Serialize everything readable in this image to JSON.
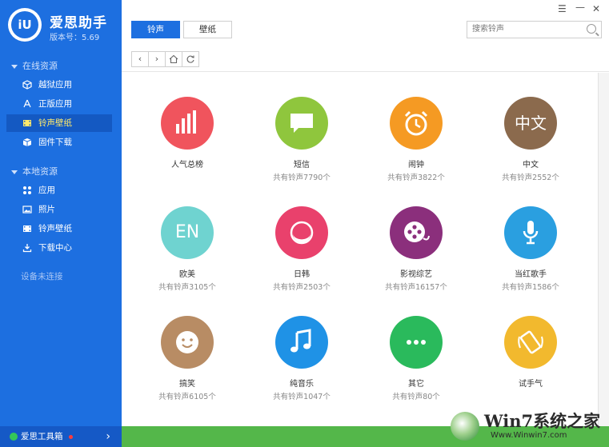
{
  "app": {
    "name": "爱思助手",
    "version": "版本号：5.69",
    "logo_text": "iU"
  },
  "sidebar": {
    "online_title": "在线资源",
    "online_items": [
      {
        "label": "越狱应用",
        "icon": "cube-icon"
      },
      {
        "label": "正版应用",
        "icon": "appstore-icon"
      },
      {
        "label": "铃声壁纸",
        "icon": "film-icon",
        "active": true
      },
      {
        "label": "固件下载",
        "icon": "box-icon"
      }
    ],
    "local_title": "本地资源",
    "local_items": [
      {
        "label": "应用",
        "icon": "apps-grid-icon"
      },
      {
        "label": "照片",
        "icon": "photo-icon"
      },
      {
        "label": "铃声壁纸",
        "icon": "film-icon"
      },
      {
        "label": "下载中心",
        "icon": "download-icon"
      }
    ],
    "device_status": "设备未连接",
    "toolbox_label": "爱思工具箱"
  },
  "topbar": {
    "tabs": [
      {
        "label": "铃声"
      },
      {
        "label": "壁纸"
      }
    ],
    "search_placeholder": "搜索铃声",
    "window_controls": [
      "menu-icon",
      "minimize-icon",
      "close-icon"
    ]
  },
  "categories": [
    {
      "name": "人气总榜",
      "count": "",
      "color": "#f0545d",
      "icon": "bar-chart-icon"
    },
    {
      "name": "短信",
      "count": "共有铃声7790个",
      "color": "#8fc63d",
      "icon": "message-icon"
    },
    {
      "name": "闹钟",
      "count": "共有铃声3822个",
      "color": "#f59a23",
      "icon": "alarm-clock-icon"
    },
    {
      "name": "中文",
      "count": "共有铃声2552个",
      "color": "#8b6a4d",
      "icon": "chinese-text-icon",
      "glyph": "中文"
    },
    {
      "name": "欧美",
      "count": "共有铃声3105个",
      "color": "#6fd3d0",
      "icon": "english-text-icon",
      "glyph": "EN"
    },
    {
      "name": "日韩",
      "count": "共有铃声2503个",
      "color": "#e9416c",
      "icon": "crescent-icon"
    },
    {
      "name": "影视综艺",
      "count": "共有铃声16157个",
      "color": "#8b2f7c",
      "icon": "film-reel-icon"
    },
    {
      "name": "当红歌手",
      "count": "共有铃声1586个",
      "color": "#2a9fe0",
      "icon": "microphone-icon"
    },
    {
      "name": "搞笑",
      "count": "共有铃声6105个",
      "color": "#b88c64",
      "icon": "smile-icon"
    },
    {
      "name": "纯音乐",
      "count": "共有铃声1047个",
      "color": "#1f92e6",
      "icon": "music-note-icon"
    },
    {
      "name": "其它",
      "count": "共有铃声80个",
      "color": "#2aba5c",
      "icon": "more-dots-icon"
    },
    {
      "name": "试手气",
      "count": "",
      "color": "#f2b92e",
      "icon": "shake-phone-icon"
    }
  ],
  "watermark": {
    "title": "Win7系统之家",
    "url": "Www.Winwin7.com"
  }
}
